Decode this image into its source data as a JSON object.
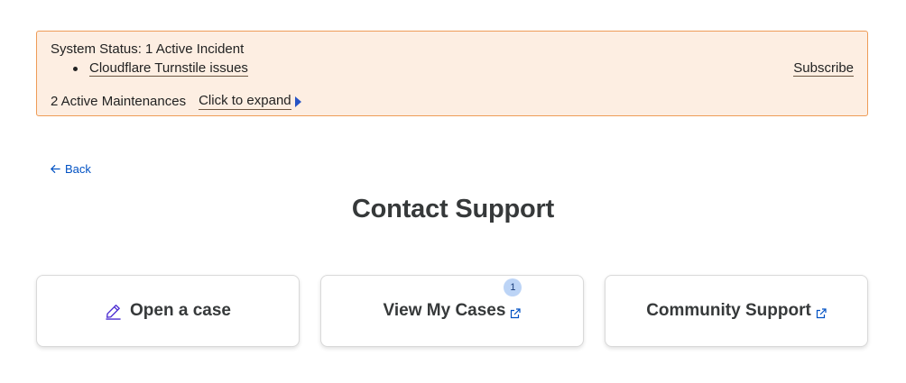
{
  "banner": {
    "status_title": "System Status: 1 Active Incident",
    "incidents": [
      {
        "label": "Cloudflare Turnstile issues"
      }
    ],
    "subscribe_label": "Subscribe",
    "maintenances_label": "2 Active Maintenances",
    "expand_label": "Click to expand",
    "colors": {
      "background": "#fdeee2",
      "border": "#ee9c57"
    }
  },
  "back": {
    "label": "Back"
  },
  "page_title": "Contact Support",
  "cards": {
    "open_case": {
      "label": "Open a case",
      "icon": "pencil-icon"
    },
    "view_cases": {
      "label": "View My Cases",
      "badge": "1",
      "icon": "external-link-icon"
    },
    "community": {
      "label": "Community Support",
      "icon": "external-link-icon"
    }
  },
  "colors": {
    "accent": "#0051c3",
    "title": "#36393a",
    "icon_purple": "#4a2bd1"
  }
}
